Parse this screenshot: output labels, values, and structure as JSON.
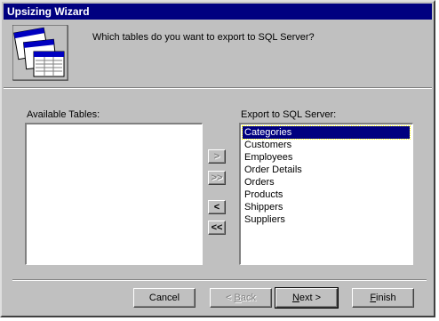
{
  "window": {
    "title": "Upsizing Wizard"
  },
  "header": {
    "question": "Which tables do you want to export to SQL Server?"
  },
  "available": {
    "label": "Available Tables:",
    "items": []
  },
  "export": {
    "label": "Export to SQL Server:",
    "items": [
      "Categories",
      "Customers",
      "Employees",
      "Order Details",
      "Orders",
      "Products",
      "Shippers",
      "Suppliers"
    ],
    "selected": "Categories"
  },
  "move_buttons": {
    "add_one": ">",
    "add_all": ">>",
    "remove_one": "<",
    "remove_all": "<<"
  },
  "footer": {
    "cancel": "Cancel",
    "back_prefix": "< ",
    "back_accel": "B",
    "back_rest": "ack",
    "next_accel": "N",
    "next_rest": "ext >",
    "finish_accel": "F",
    "finish_rest": "inish"
  }
}
